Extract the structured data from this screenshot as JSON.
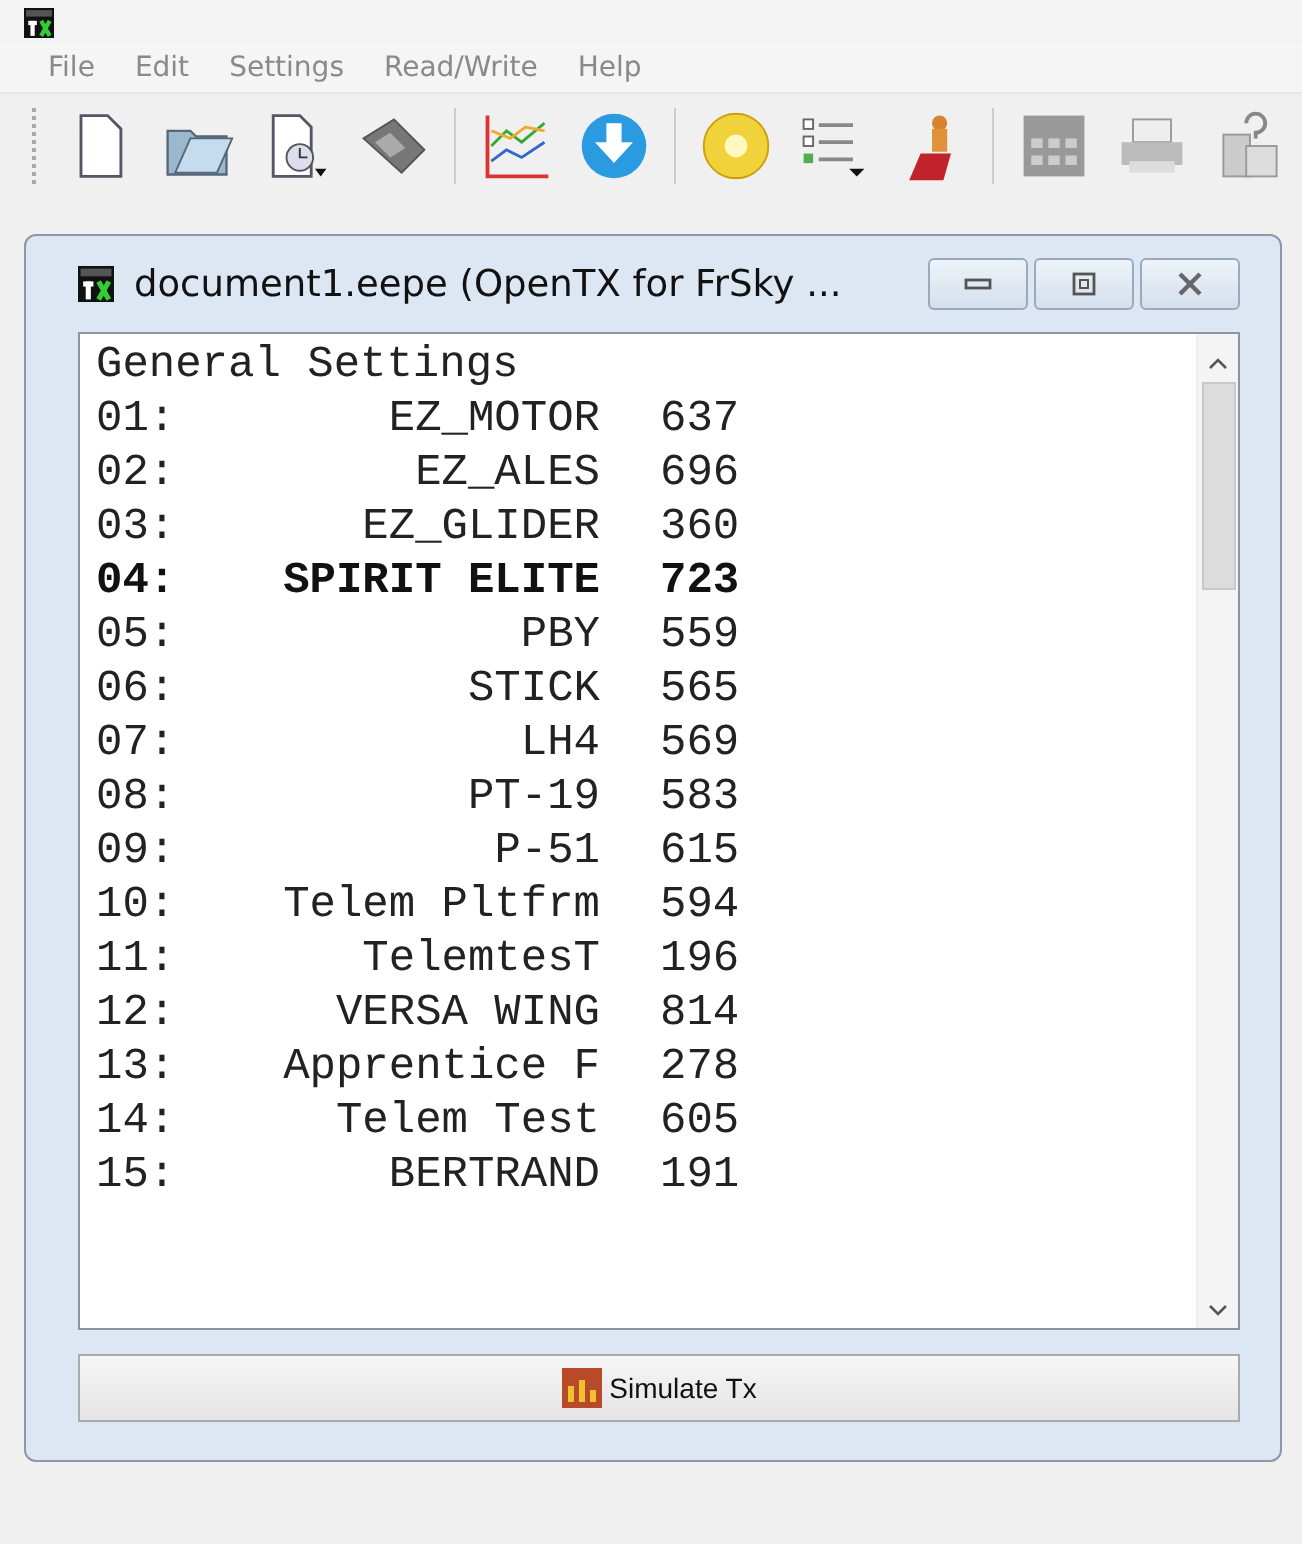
{
  "menu": [
    "File",
    "Edit",
    "Settings",
    "Read/Write",
    "Help"
  ],
  "window": {
    "title": "document1.eepe (OpenTX for FrSky ..."
  },
  "list": {
    "header": "General Settings",
    "rows": [
      {
        "num": "01:",
        "name": "EZ_MOTOR",
        "value": "637",
        "selected": false
      },
      {
        "num": "02:",
        "name": "EZ_ALES",
        "value": "696",
        "selected": false
      },
      {
        "num": "03:",
        "name": "EZ_GLIDER",
        "value": "360",
        "selected": false
      },
      {
        "num": "04:",
        "name": "SPIRIT ELITE",
        "value": "723",
        "selected": true
      },
      {
        "num": "05:",
        "name": "PBY",
        "value": "559",
        "selected": false
      },
      {
        "num": "06:",
        "name": "STICK",
        "value": "565",
        "selected": false
      },
      {
        "num": "07:",
        "name": "LH4",
        "value": "569",
        "selected": false
      },
      {
        "num": "08:",
        "name": "PT-19",
        "value": "583",
        "selected": false
      },
      {
        "num": "09:",
        "name": "P-51",
        "value": "615",
        "selected": false
      },
      {
        "num": "10:",
        "name": "Telem Pltfrm",
        "value": "594",
        "selected": false
      },
      {
        "num": "11:",
        "name": "TelemtesT",
        "value": "196",
        "selected": false
      },
      {
        "num": "12:",
        "name": "VERSA WING",
        "value": "814",
        "selected": false
      },
      {
        "num": "13:",
        "name": "Apprentice F",
        "value": "278",
        "selected": false
      },
      {
        "num": "14:",
        "name": "Telem Test",
        "value": "605",
        "selected": false
      },
      {
        "num": "15:",
        "name": "BERTRAND",
        "value": "191",
        "selected": false
      }
    ]
  },
  "button": "Simulate Tx"
}
